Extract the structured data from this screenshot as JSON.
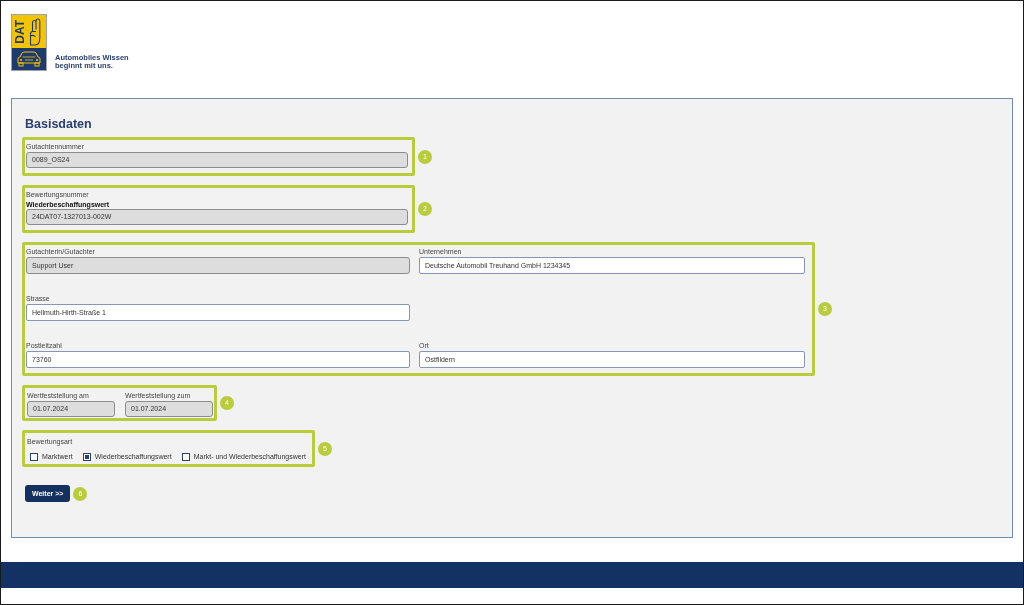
{
  "logo": {
    "wordmark": "DAT",
    "tagline": [
      "Automobiles Wissen",
      "beginnt mit uns."
    ]
  },
  "form": {
    "title": "Basisdaten",
    "groups": [
      {
        "kind": "single",
        "callout": "1",
        "fields": [
          {
            "label": "Gutachtennummer",
            "value": "0089_OS24",
            "readonly": true
          }
        ]
      },
      {
        "kind": "single",
        "callout": "2",
        "fields": [
          {
            "label": "Bewertungsnummer",
            "sublabel": "Wiederbeschaffungswert",
            "value": "24DAT07-1327013-002W",
            "readonly": true
          }
        ]
      },
      {
        "kind": "grid",
        "callout": "3",
        "rows": [
          [
            {
              "label": "Gutachterin/Gutachter",
              "value": "Support User",
              "readonly": true
            },
            {
              "label": "Unternehmen",
              "value": "Deutsche Automobil Treuhand GmbH 1234345",
              "readonly": false
            }
          ],
          [
            {
              "label": "Strasse",
              "value": "Hellmuth-Hirth-Straße 1",
              "readonly": false
            }
          ],
          [
            {
              "label": "Postleitzahl",
              "value": "73760",
              "readonly": false
            },
            {
              "label": "Ort",
              "value": "Ostfildern",
              "readonly": false
            }
          ]
        ]
      },
      {
        "kind": "dates",
        "callout": "4",
        "fields": [
          {
            "label": "Wertfeststellung am",
            "value": "01.07.2024",
            "readonly": true
          },
          {
            "label": "Wertfeststellung zum",
            "value": "01.07.2024",
            "readonly": true
          }
        ]
      },
      {
        "kind": "choice",
        "callout": "5",
        "label": "Bewertungsart",
        "options": [
          {
            "label": "Marktwert",
            "selected": false
          },
          {
            "label": "Wiederbeschaffungswert",
            "selected": true
          },
          {
            "label": "Markt- und Wiederbeschaffungswert",
            "selected": false
          }
        ]
      }
    ],
    "submit": {
      "label": "Weiter >>",
      "callout": "6"
    }
  }
}
